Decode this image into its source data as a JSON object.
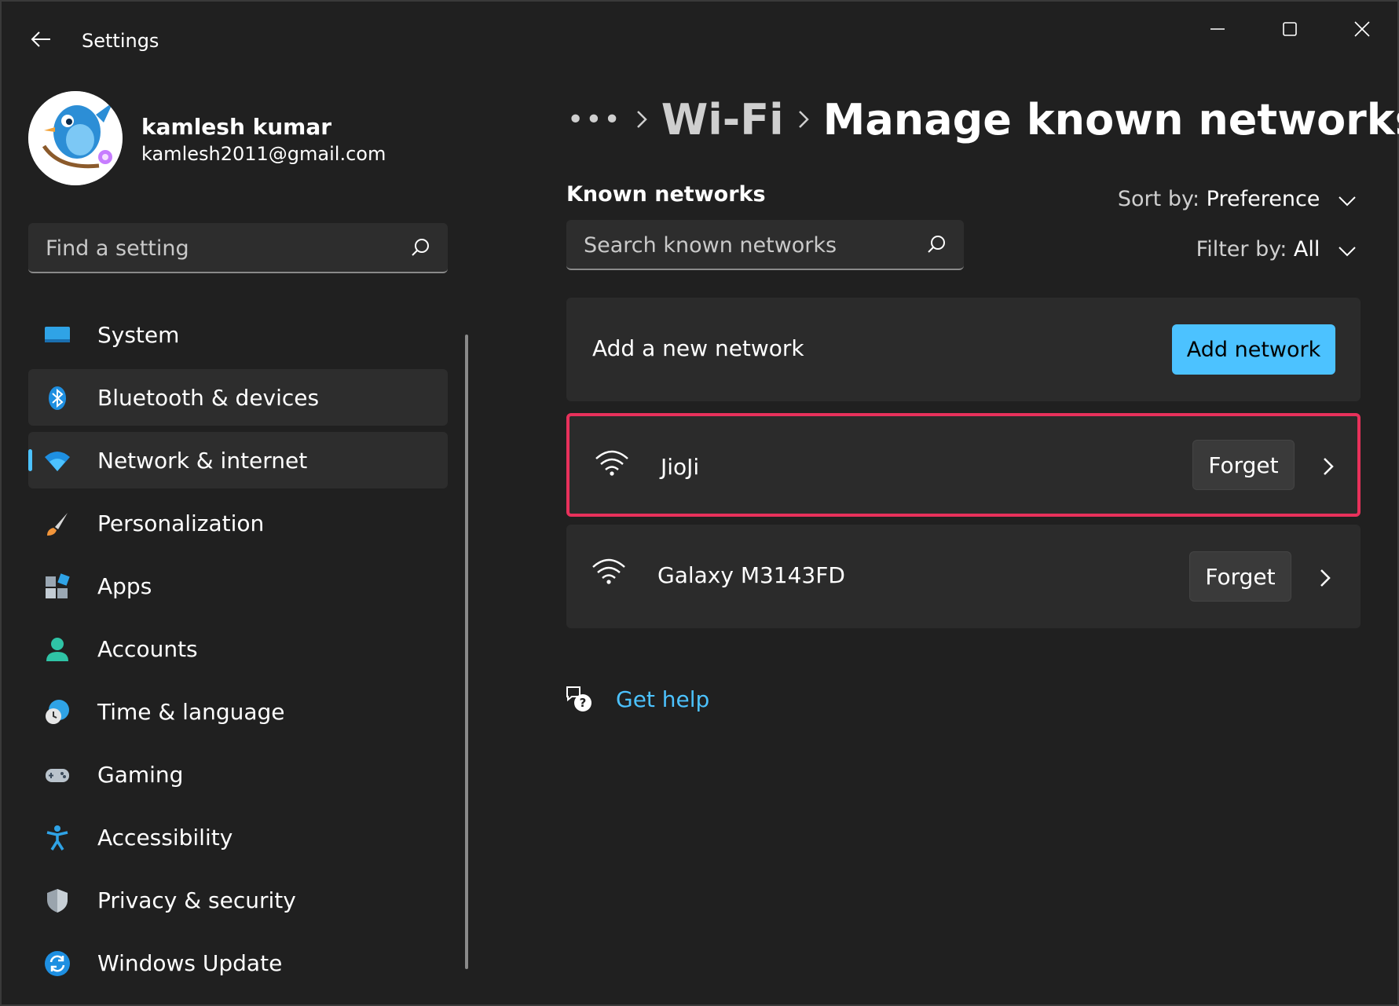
{
  "window": {
    "title": "Settings"
  },
  "profile": {
    "name": "kamlesh kumar",
    "email": "kamlesh2011@gmail.com"
  },
  "search": {
    "placeholder": "Find a setting"
  },
  "sidebar": {
    "items": [
      {
        "label": "System",
        "icon": "system-icon"
      },
      {
        "label": "Bluetooth & devices",
        "icon": "bluetooth-icon"
      },
      {
        "label": "Network & internet",
        "icon": "wifi-icon",
        "selected": true
      },
      {
        "label": "Personalization",
        "icon": "brush-icon"
      },
      {
        "label": "Apps",
        "icon": "apps-icon"
      },
      {
        "label": "Accounts",
        "icon": "person-icon"
      },
      {
        "label": "Time & language",
        "icon": "clock-globe-icon"
      },
      {
        "label": "Gaming",
        "icon": "gamepad-icon"
      },
      {
        "label": "Accessibility",
        "icon": "accessibility-icon"
      },
      {
        "label": "Privacy & security",
        "icon": "shield-icon"
      },
      {
        "label": "Windows Update",
        "icon": "update-icon"
      }
    ]
  },
  "breadcrumb": {
    "more": "•••",
    "parent": "Wi-Fi",
    "current": "Manage known networks"
  },
  "known_networks": {
    "title": "Known networks",
    "search_placeholder": "Search known networks",
    "sort_label": "Sort by:",
    "sort_value": "Preference",
    "filter_label": "Filter by:",
    "filter_value": "All",
    "add_label": "Add a new network",
    "add_button": "Add network",
    "networks": [
      {
        "name": "JioJi",
        "forget": "Forget",
        "highlighted": true
      },
      {
        "name": "Galaxy M3143FD",
        "forget": "Forget"
      }
    ]
  },
  "help": {
    "label": "Get help"
  },
  "colors": {
    "accent": "#4cc2ff",
    "highlight_border": "#e8315b",
    "background": "#202020",
    "card": "#2b2b2b"
  }
}
